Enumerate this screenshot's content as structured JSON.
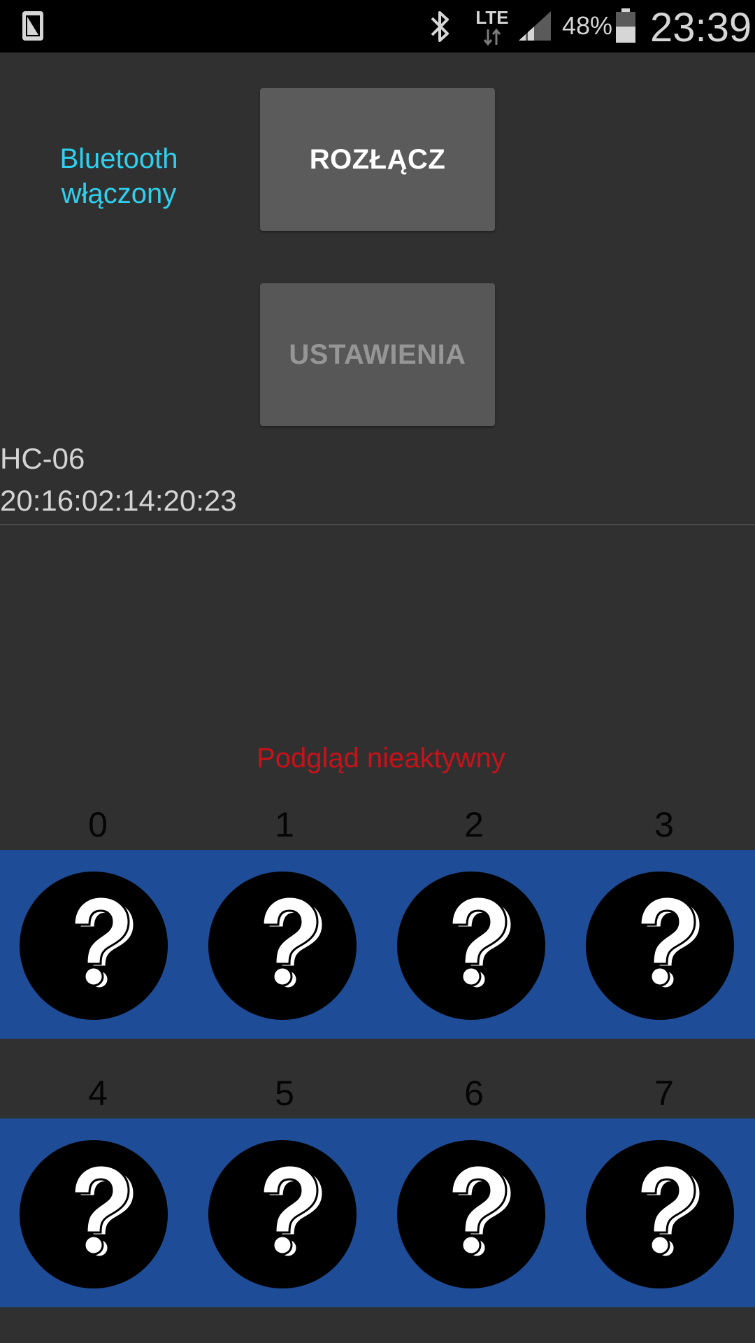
{
  "status_bar": {
    "network": "LTE",
    "battery_percent": "48%",
    "time": "23:39",
    "icons": [
      "sim-card-icon",
      "bluetooth-icon",
      "lte-data-icon",
      "signal-strength-icon",
      "battery-icon"
    ]
  },
  "bluetooth": {
    "status_line1": "Bluetooth",
    "status_line2": "włączony"
  },
  "buttons": {
    "disconnect_label": "ROZŁĄCZ",
    "settings_label": "USTAWIENIA"
  },
  "device": {
    "name": "HC-06",
    "address": "20:16:02:14:20:23"
  },
  "preview": {
    "status": "Podgląd nieaktywny"
  },
  "sensors": {
    "row1": [
      "0",
      "1",
      "2",
      "3"
    ],
    "row2": [
      "4",
      "5",
      "6",
      "7"
    ],
    "icon": "question-mark-icon"
  },
  "colors": {
    "background": "#303030",
    "accent_cyan": "#2fd0ee",
    "inactive_red": "#c8121a",
    "band_blue": "#1e4c96"
  }
}
